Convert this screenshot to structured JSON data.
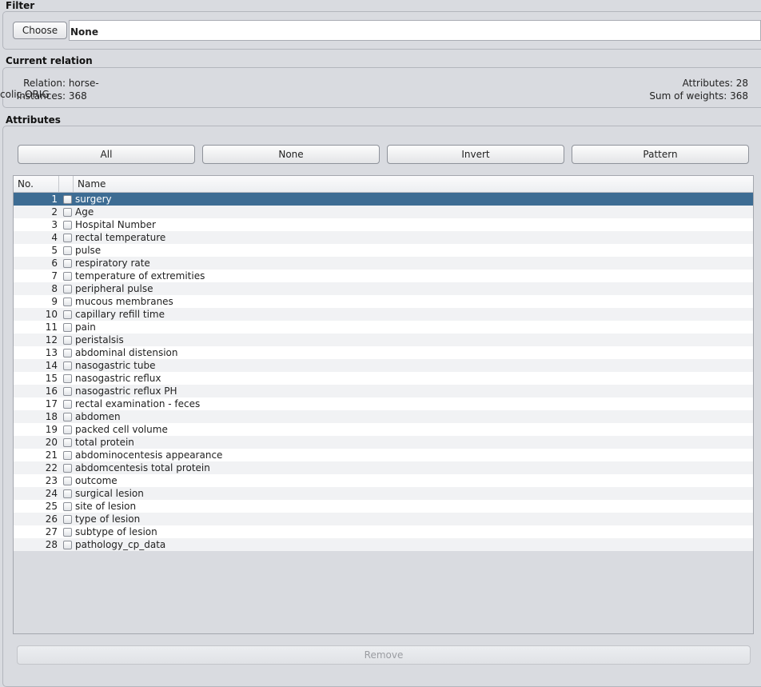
{
  "filter": {
    "title": "Filter",
    "choose_label": "Choose",
    "value": "None"
  },
  "relation": {
    "title": "Current relation",
    "relation_label": "Relation:",
    "relation_value": "horse-colic.ORIG",
    "instances_label": "Instances:",
    "instances_value": "368",
    "attributes_label": "Attributes:",
    "attributes_value": "28",
    "weights_label": "Sum of weights:",
    "weights_value": "368"
  },
  "attributes": {
    "title": "Attributes",
    "buttons": {
      "all": "All",
      "none": "None",
      "invert": "Invert",
      "pattern": "Pattern"
    },
    "columns": {
      "no": "No.",
      "name": "Name"
    },
    "selected_index": 0,
    "rows": [
      {
        "no": "1",
        "name": "surgery"
      },
      {
        "no": "2",
        "name": "Age"
      },
      {
        "no": "3",
        "name": "Hospital Number"
      },
      {
        "no": "4",
        "name": "rectal temperature"
      },
      {
        "no": "5",
        "name": "pulse"
      },
      {
        "no": "6",
        "name": "respiratory rate"
      },
      {
        "no": "7",
        "name": "temperature of extremities"
      },
      {
        "no": "8",
        "name": "peripheral pulse"
      },
      {
        "no": "9",
        "name": "mucous membranes"
      },
      {
        "no": "10",
        "name": "capillary refill time"
      },
      {
        "no": "11",
        "name": "pain"
      },
      {
        "no": "12",
        "name": "peristalsis"
      },
      {
        "no": "13",
        "name": "abdominal distension"
      },
      {
        "no": "14",
        "name": "nasogastric tube"
      },
      {
        "no": "15",
        "name": "nasogastric reflux"
      },
      {
        "no": "16",
        "name": "nasogastric reflux PH"
      },
      {
        "no": "17",
        "name": "rectal examination - feces"
      },
      {
        "no": "18",
        "name": "abdomen"
      },
      {
        "no": "19",
        "name": "packed cell volume"
      },
      {
        "no": "20",
        "name": "total protein"
      },
      {
        "no": "21",
        "name": "abdominocentesis appearance"
      },
      {
        "no": "22",
        "name": "abdomcentesis total protein"
      },
      {
        "no": "23",
        "name": "outcome"
      },
      {
        "no": "24",
        "name": "surgical lesion"
      },
      {
        "no": "25",
        "name": "site of lesion"
      },
      {
        "no": "26",
        "name": "type of lesion"
      },
      {
        "no": "27",
        "name": "subtype of lesion"
      },
      {
        "no": "28",
        "name": "pathology_cp_data"
      }
    ],
    "remove_label": "Remove"
  }
}
